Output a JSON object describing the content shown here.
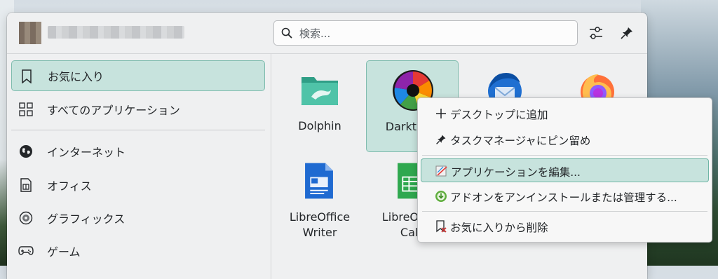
{
  "header": {
    "search_placeholder": "検索...",
    "icons": [
      "search-icon",
      "filter-settings-icon",
      "pin-icon"
    ]
  },
  "sidebar": {
    "items": [
      {
        "label": "お気に入り",
        "icon": "bookmark-icon",
        "active": true
      },
      {
        "label": "すべてのアプリケーション",
        "icon": "grid-icon",
        "active": false
      },
      {
        "label": "インターネット",
        "icon": "globe-icon",
        "active": false
      },
      {
        "label": "オフィス",
        "icon": "office-icon",
        "active": false
      },
      {
        "label": "グラフィックス",
        "icon": "graphics-icon",
        "active": false
      },
      {
        "label": "ゲーム",
        "icon": "gamepad-icon",
        "active": false
      }
    ]
  },
  "favorites": {
    "apps": [
      {
        "name": "Dolphin",
        "icon": "dolphin-folder-icon",
        "selected": false
      },
      {
        "name": "Darktable",
        "icon": "darktable-aperture-icon",
        "selected": true
      },
      {
        "name": "",
        "icon": "thunderbird-icon",
        "selected": false
      },
      {
        "name": "",
        "icon": "firefox-icon",
        "selected": false
      },
      {
        "name": "LibreOffice\nWriter",
        "icon": "libreoffice-writer-icon",
        "selected": false
      },
      {
        "name": "LibreOffice\nCalc",
        "icon": "libreoffice-calc-icon",
        "selected": false
      }
    ]
  },
  "context_menu": {
    "items": [
      {
        "label": "デスクトップに追加",
        "icon": "plus-icon",
        "highlighted": false
      },
      {
        "label": "タスクマネージャにピン留め",
        "icon": "pin-icon",
        "highlighted": false
      },
      {
        "label": "アプリケーションを編集...",
        "icon": "edit-application-icon",
        "highlighted": true
      },
      {
        "label": "アドオンをアンインストールまたは管理する...",
        "icon": "addon-download-icon",
        "highlighted": false
      },
      {
        "label": "お気に入りから削除",
        "icon": "remove-favorite-icon",
        "highlighted": false
      }
    ]
  },
  "colors": {
    "accent_bg": "#c7e3dd",
    "accent_border": "#7fbcae",
    "panel_bg": "#eff0f1"
  }
}
